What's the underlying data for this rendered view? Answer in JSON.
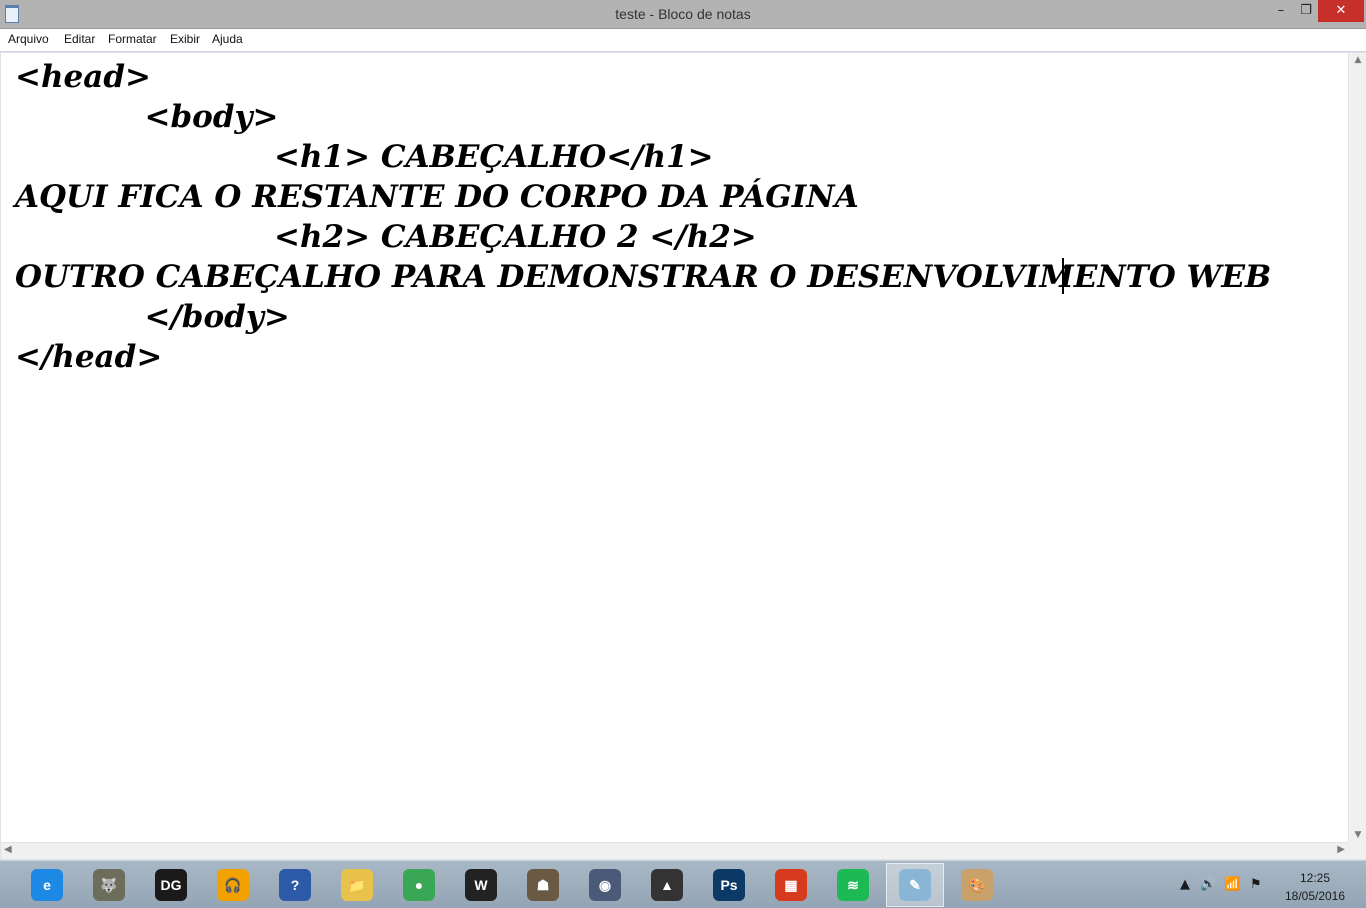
{
  "window": {
    "title": "teste - Bloco de notas",
    "min_glyph": "–",
    "max_glyph": "❐",
    "close_glyph": "✕"
  },
  "menu": {
    "items": [
      "Arquivo",
      "Editar",
      "Formatar",
      "Exibir",
      "Ajuda"
    ]
  },
  "editor": {
    "lines": [
      "<head>",
      "            <body>",
      "                        <h1> CABEÇALHO</h1>",
      "AQUI FICA O RESTANTE DO CORPO DA PÁGINA",
      "                        <h2> CABEÇALHO 2 </h2>",
      "OUTRO CABEÇALHO PARA DEMONSTRAR O DESENVOLVIMENTO WEB",
      "            </body>",
      "</head>"
    ]
  },
  "taskbar": {
    "apps": [
      {
        "name": "internet-explorer-icon",
        "label": "e",
        "color": "#1e88e5"
      },
      {
        "name": "gimp-icon",
        "label": "🐺",
        "color": "#6d6d5b"
      },
      {
        "name": "game-dg-icon",
        "label": "DG",
        "color": "#1a1a1a"
      },
      {
        "name": "audacity-icon",
        "label": "🎧",
        "color": "#f2a200"
      },
      {
        "name": "help-icon",
        "label": "?",
        "color": "#2d5aa8"
      },
      {
        "name": "file-explorer-icon",
        "label": "📁",
        "color": "#e8c24a"
      },
      {
        "name": "chrome-icon",
        "label": "●",
        "color": "#3aa757"
      },
      {
        "name": "warframe-icon",
        "label": "W",
        "color": "#222"
      },
      {
        "name": "soldier-game-icon",
        "label": "☗",
        "color": "#6b5a43"
      },
      {
        "name": "steam-icon",
        "label": "◉",
        "color": "#4a5a78"
      },
      {
        "name": "inkscape-icon",
        "label": "▲",
        "color": "#333"
      },
      {
        "name": "photoshop-icon",
        "label": "Ps",
        "color": "#0b3a66"
      },
      {
        "name": "ms-windows-icon",
        "label": "▦",
        "color": "#d63b1e"
      },
      {
        "name": "spotify-icon",
        "label": "≋",
        "color": "#1db954"
      },
      {
        "name": "notepad-icon",
        "label": "✎",
        "color": "#8ab6d6"
      },
      {
        "name": "paint-icon",
        "label": "🎨",
        "color": "#c9a26b"
      }
    ],
    "active_index": 14
  },
  "tray": {
    "show_hidden_glyph": "▲",
    "volume_glyph": "🔊",
    "network_glyph": "📶",
    "flag_glyph": "⚑",
    "time": "12:25",
    "date": "18/05/2016"
  }
}
